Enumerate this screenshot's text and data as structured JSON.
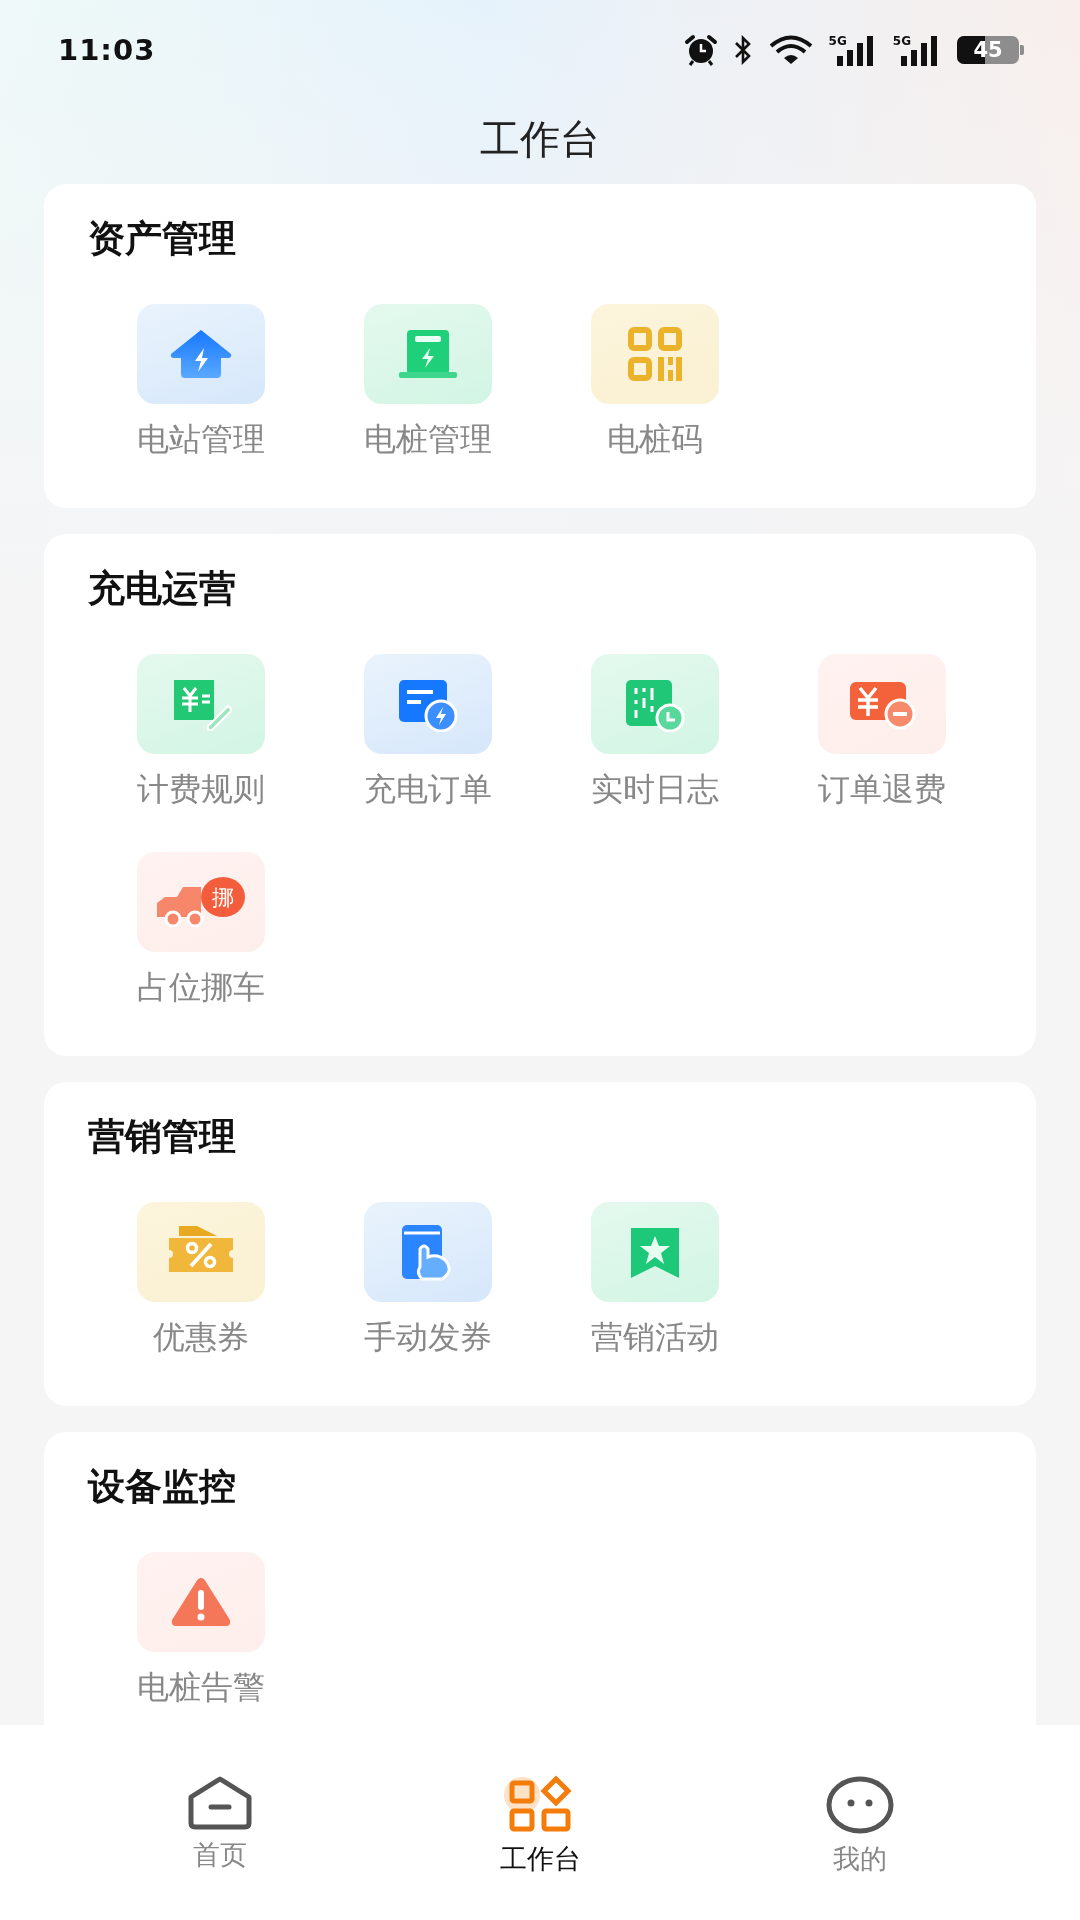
{
  "status_bar": {
    "time": "11:03",
    "networks": [
      "5G",
      "5G"
    ],
    "battery": "45"
  },
  "title": "工作台",
  "sections": [
    {
      "title": "资产管理",
      "items": [
        {
          "label": "电站管理",
          "kind": "house-bolt"
        },
        {
          "label": "电桩管理",
          "kind": "charger"
        },
        {
          "label": "电桩码",
          "kind": "qr"
        }
      ]
    },
    {
      "title": "充电运营",
      "items": [
        {
          "label": "计费规则",
          "kind": "receipt"
        },
        {
          "label": "充电订单",
          "kind": "order"
        },
        {
          "label": "实时日志",
          "kind": "log"
        },
        {
          "label": "订单退费",
          "kind": "refund"
        },
        {
          "label": "占位挪车",
          "kind": "truck",
          "badge": "挪"
        }
      ]
    },
    {
      "title": "营销管理",
      "items": [
        {
          "label": "优惠券",
          "kind": "coupon"
        },
        {
          "label": "手动发券",
          "kind": "hand"
        },
        {
          "label": "营销活动",
          "kind": "bookmark"
        }
      ]
    },
    {
      "title": "设备监控",
      "items": [
        {
          "label": "电桩告警",
          "kind": "warning"
        }
      ]
    }
  ],
  "nav": [
    {
      "label": "首页",
      "kind": "home",
      "selected": false
    },
    {
      "label": "工作台",
      "kind": "grid",
      "selected": true
    },
    {
      "label": "我的",
      "kind": "face",
      "selected": false
    }
  ]
}
